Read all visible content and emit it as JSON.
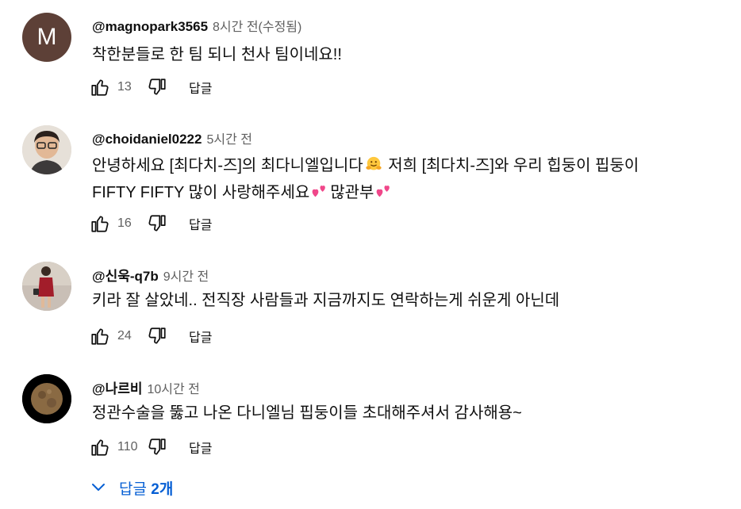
{
  "comments": [
    {
      "avatar_letter": "M",
      "author": "@magnopark3565",
      "time": "8시간 전(수정됨)",
      "text_lines": [
        "착한분들로 한 팀 되니 천사 팀이네요!!"
      ],
      "likes": "13",
      "reply_label": "답글"
    },
    {
      "author": "@choidaniel0222",
      "time": "5시간 전",
      "text_line1_a": "안녕하세요 [최다치-즈]의 최다니엘입니다",
      "text_line1_b": " 저희 [최다치-즈]와 우리 힙둥이 핍둥이",
      "text_line2_a": "FIFTY FIFTY 많이 사랑해주세요",
      "text_line2_b": "많관부",
      "likes": "16",
      "reply_label": "답글"
    },
    {
      "author": "@신욱-q7b",
      "time": "9시간 전",
      "text_lines": [
        "키라 잘 살았네.. 전직장 사람들과 지금까지도 연락하는게 쉬운게 아닌데"
      ],
      "likes": "24",
      "reply_label": "답글"
    },
    {
      "author": "@나르비",
      "time": "10시간 전",
      "text_lines": [
        "정관수술을 뚫고 나온 다니엘님 핍둥이들 초대해주셔서 감사해용~"
      ],
      "likes": "110",
      "reply_label": "답글"
    }
  ],
  "replies_toggle": {
    "label": "답글",
    "count": "2개"
  },
  "icons": {
    "like": "thumbs-up-icon",
    "dislike": "thumbs-down-icon",
    "hug_emoji": "hugging-face-emoji",
    "hearts_emoji": "two-hearts-emoji",
    "chevron": "chevron-down-icon"
  },
  "colors": {
    "link": "#065fd4",
    "secondary_text": "#606060",
    "avatar_m": "#5d4037"
  }
}
